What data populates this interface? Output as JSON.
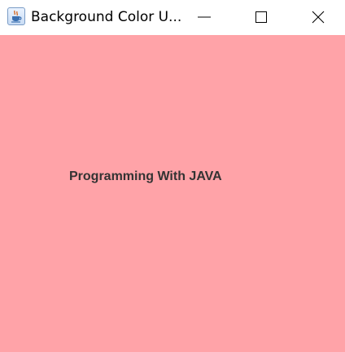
{
  "window": {
    "title": "Background Color U...",
    "app_icon": "java-coffee-cup-icon",
    "controls": {
      "minimize_icon": "minimize-icon",
      "maximize_icon": "maximize-icon",
      "close_icon": "close-icon"
    }
  },
  "content": {
    "background_color": "#ffa3a8",
    "label": "Programming With JAVA",
    "label_color": "#333333"
  }
}
